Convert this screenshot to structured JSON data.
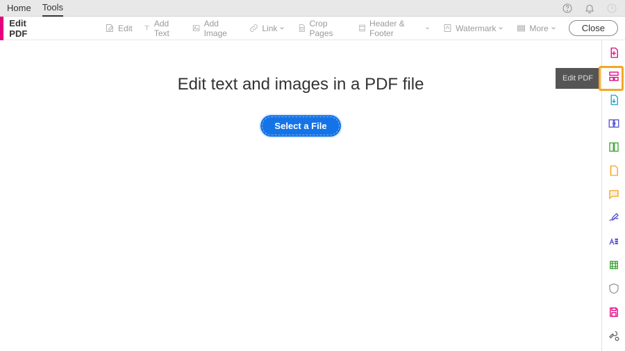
{
  "topnav": {
    "tabs": [
      "Home",
      "Tools"
    ],
    "active_index": 1
  },
  "toolbar": {
    "title": "Edit PDF",
    "items": [
      {
        "id": "edit",
        "label": "Edit",
        "dropdown": false
      },
      {
        "id": "add-text",
        "label": "Add Text",
        "dropdown": false
      },
      {
        "id": "add-image",
        "label": "Add Image",
        "dropdown": false
      },
      {
        "id": "link",
        "label": "Link",
        "dropdown": true
      },
      {
        "id": "crop",
        "label": "Crop Pages",
        "dropdown": false
      },
      {
        "id": "header-footer",
        "label": "Header & Footer",
        "dropdown": true
      },
      {
        "id": "watermark",
        "label": "Watermark",
        "dropdown": true
      },
      {
        "id": "more",
        "label": "More",
        "dropdown": true
      }
    ],
    "close": "Close"
  },
  "main": {
    "headline": "Edit text and images in a PDF file",
    "select_button": "Select a File"
  },
  "rail": {
    "tooltip": "Edit PDF",
    "items": [
      {
        "id": "create-pdf",
        "color": "#e6007e"
      },
      {
        "id": "edit-pdf",
        "color": "#e6007e",
        "active": true
      },
      {
        "id": "export-pdf",
        "color": "#1aa3c9"
      },
      {
        "id": "organize",
        "color": "#5856d6"
      },
      {
        "id": "enhance-scans",
        "color": "#3fa535"
      },
      {
        "id": "combine",
        "color": "#f5a623"
      },
      {
        "id": "comment",
        "color": "#f5a623"
      },
      {
        "id": "fill-sign",
        "color": "#5856d6"
      },
      {
        "id": "redact",
        "color": "#5856d6"
      },
      {
        "id": "optimize",
        "color": "#3fa535"
      },
      {
        "id": "protect",
        "color": "#9a9a9a"
      },
      {
        "id": "save",
        "color": "#e6007e"
      },
      {
        "id": "settings-tool",
        "color": "#6a6a6a"
      }
    ]
  }
}
